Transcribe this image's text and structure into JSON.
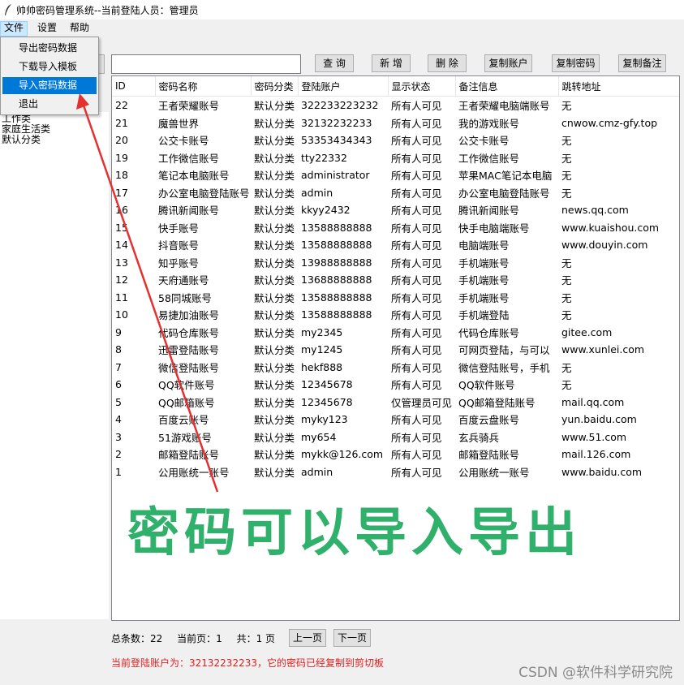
{
  "app": {
    "title": "帅帅密码管理系统--当前登陆人员：管理员"
  },
  "menu": {
    "file": "文件",
    "settings": "设置",
    "help": "帮助"
  },
  "file_menu": {
    "items": [
      {
        "label": "导出密码数据"
      },
      {
        "label": "下载导入模板"
      },
      {
        "label": "导入密码数据"
      },
      {
        "label": "退出"
      }
    ],
    "highlighted": "导入密码数据"
  },
  "toolbar": {
    "search_value": "",
    "query": "查 询",
    "add": "新 增",
    "delete": "删 除",
    "copy_account": "复制账户",
    "copy_password": "复制密码",
    "copy_note": "复制备注"
  },
  "sidebar": {
    "categories": [
      "工作类",
      "家庭生活类",
      "默认分类"
    ]
  },
  "table": {
    "columns": [
      "ID",
      "密码名称",
      "密码分类",
      "登陆账户",
      "显示状态",
      "备注信息",
      "跳转地址"
    ],
    "rows": [
      [
        "22",
        "王者荣耀账号",
        "默认分类",
        "322233223232",
        "所有人可见",
        "王者荣耀电脑端账号",
        "无"
      ],
      [
        "21",
        "魔兽世界",
        "默认分类",
        "32132232233",
        "所有人可见",
        "我的游戏账号",
        "cnwow.cmz-gfy.top"
      ],
      [
        "20",
        "公交卡账号",
        "默认分类",
        "53353434343",
        "所有人可见",
        "公交卡账号",
        "无"
      ],
      [
        "19",
        "工作微信账号",
        "默认分类",
        "tty22332",
        "所有人可见",
        "工作微信账号",
        "无"
      ],
      [
        "18",
        "笔记本电脑账号",
        "默认分类",
        "administrator",
        "所有人可见",
        "苹果MAC笔记本电脑",
        "无"
      ],
      [
        "17",
        "办公室电脑登陆账号",
        "默认分类",
        "admin",
        "所有人可见",
        "办公室电脑登陆账号",
        "无"
      ],
      [
        "16",
        "腾讯新闻账号",
        "默认分类",
        "kkyy2432",
        "所有人可见",
        "腾讯新闻账号",
        "news.qq.com"
      ],
      [
        "15",
        "快手账号",
        "默认分类",
        "13588888888",
        "所有人可见",
        "快手电脑端账号",
        "www.kuaishou.com"
      ],
      [
        "14",
        "抖音账号",
        "默认分类",
        "13588888888",
        "所有人可见",
        "电脑端账号",
        "www.douyin.com"
      ],
      [
        "13",
        "知乎账号",
        "默认分类",
        "13988888888",
        "所有人可见",
        "手机端账号",
        "无"
      ],
      [
        "12",
        "天府通账号",
        "默认分类",
        "13688888888",
        "所有人可见",
        "手机端账号",
        "无"
      ],
      [
        "11",
        "58同城账号",
        "默认分类",
        "13588888888",
        "所有人可见",
        "手机端账号",
        "无"
      ],
      [
        "10",
        "易捷加油账号",
        "默认分类",
        "13588888888",
        "所有人可见",
        "手机端登陆",
        "无"
      ],
      [
        "9",
        "代码仓库账号",
        "默认分类",
        "my2345",
        "所有人可见",
        "代码仓库账号",
        "gitee.com"
      ],
      [
        "8",
        "迅雷登陆账号",
        "默认分类",
        "my1245",
        "所有人可见",
        "可网页登陆，与可以",
        "www.xunlei.com"
      ],
      [
        "7",
        "微信登陆账号",
        "默认分类",
        "hekf888",
        "所有人可见",
        "微信登陆账号，手机",
        "无"
      ],
      [
        "6",
        "QQ软件账号",
        "默认分类",
        "12345678",
        "所有人可见",
        "QQ软件账号",
        "无"
      ],
      [
        "5",
        "QQ邮箱账号",
        "默认分类",
        "12345678",
        "仅管理员可见",
        "QQ邮箱登陆账号",
        "mail.qq.com"
      ],
      [
        "4",
        "百度云账号",
        "默认分类",
        "myky123",
        "所有人可见",
        "百度云盘账号",
        "yun.baidu.com"
      ],
      [
        "3",
        "51游戏账号",
        "默认分类",
        "my654",
        "所有人可见",
        "玄兵骑兵",
        "www.51.com"
      ],
      [
        "2",
        "邮箱登陆账号",
        "默认分类",
        "mykk@126.com",
        "所有人可见",
        "邮箱登陆账号",
        "mail.126.com"
      ],
      [
        "1",
        "公用账统一账号",
        "默认分类",
        "admin",
        "所有人可见",
        "公用账统一账号",
        "www.baidu.com"
      ]
    ]
  },
  "overlay": {
    "text": "密码可以导入导出",
    "color": "#2fb06b"
  },
  "footer": {
    "total": "总条数：22",
    "current_page": "当前页：1",
    "pages": "共：1 页",
    "prev": "上一页",
    "next": "下一页"
  },
  "status": {
    "message": "当前登陆账户为：32132232233，它的密码已经复制到剪切板",
    "color": "#e02020"
  },
  "watermark": "CSDN @软件科学研究院",
  "icons": {
    "app": "feather-icon",
    "annotation": "red-arrow"
  }
}
